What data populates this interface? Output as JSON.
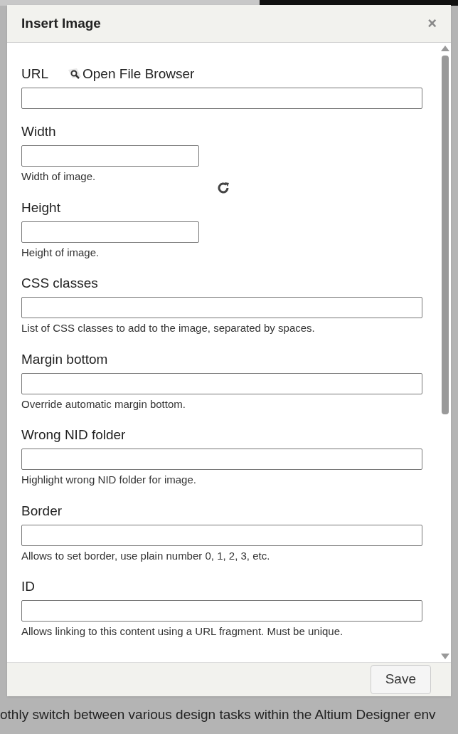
{
  "background": {
    "bottom_text": "othly switch between various design tasks within the Altium Designer env"
  },
  "dialog": {
    "title": "Insert Image",
    "close": "×",
    "fields": [
      {
        "label": "URL",
        "link": "Open File Browser",
        "kind": "wide"
      },
      {
        "label": "Width",
        "help": "Width of image.",
        "kind": "narrow"
      },
      {
        "label": "Height",
        "help": "Height of image.",
        "kind": "narrow"
      },
      {
        "label": "CSS classes",
        "help": "List of CSS classes to add to the image, separated by spaces.",
        "kind": "wide"
      },
      {
        "label": "Margin bottom",
        "help": "Override automatic margin bottom.",
        "kind": "wide"
      },
      {
        "label": "Wrong NID folder",
        "help": "Highlight wrong NID folder for image.",
        "kind": "wide"
      },
      {
        "label": "Border",
        "help": "Allows to set border, use plain number 0, 1, 2, 3, etc.",
        "kind": "wide"
      },
      {
        "label": "ID",
        "help": "Allows linking to this content using a URL fragment. Must be unique.",
        "kind": "wide"
      }
    ],
    "buttons": [
      "Save"
    ]
  }
}
